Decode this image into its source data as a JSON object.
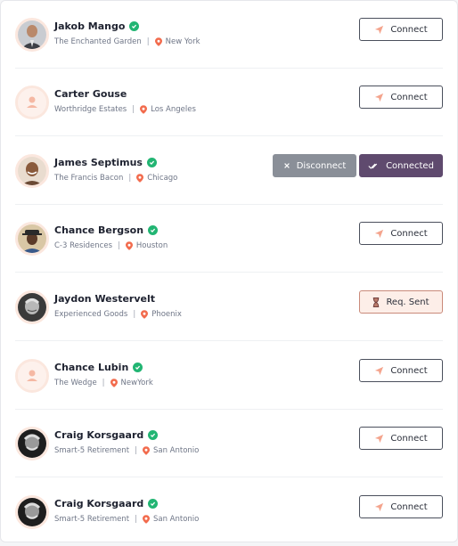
{
  "colors": {
    "accent": "#f26b4d",
    "verified": "#22b573",
    "connected_bg": "#5f4a6e",
    "disconnect_bg": "#8a8f98",
    "request_bg": "#fdeee8"
  },
  "people": [
    {
      "name": "Jakob Mango",
      "verified": true,
      "company": "The Enchanted Garden",
      "location": "New York",
      "avatar": "photo-suit",
      "action": "Connect"
    },
    {
      "name": "Carter Gouse",
      "verified": false,
      "company": "Worthridge Estates",
      "location": "Los Angeles",
      "avatar": "placeholder",
      "action": "Connect"
    },
    {
      "name": "James Septimus",
      "verified": true,
      "company": "The Francis Bacon",
      "location": "Chicago",
      "avatar": "photo-smile",
      "action": "Connected",
      "secondary_action": "Disconnect"
    },
    {
      "name": "Chance Bergson",
      "verified": true,
      "company": "C-3 Residences",
      "location": "Houston",
      "avatar": "photo-hat",
      "action": "Connect"
    },
    {
      "name": "Jaydon Westervelt",
      "verified": false,
      "company": "Experienced Goods",
      "location": "Phoenix",
      "avatar": "photo-bw",
      "action": "Req. Sent"
    },
    {
      "name": "Chance Lubin",
      "verified": true,
      "company": "The Wedge",
      "location": "NewYork",
      "avatar": "placeholder",
      "action": "Connect"
    },
    {
      "name": "Craig Korsgaard",
      "verified": true,
      "company": "Smart-5 Retirement",
      "location": "San Antonio",
      "avatar": "photo-bw-dark",
      "action": "Connect"
    },
    {
      "name": "Craig Korsgaard",
      "verified": true,
      "company": "Smart-5 Retirement",
      "location": "San Antonio",
      "avatar": "photo-bw-dark",
      "action": "Connect"
    }
  ]
}
